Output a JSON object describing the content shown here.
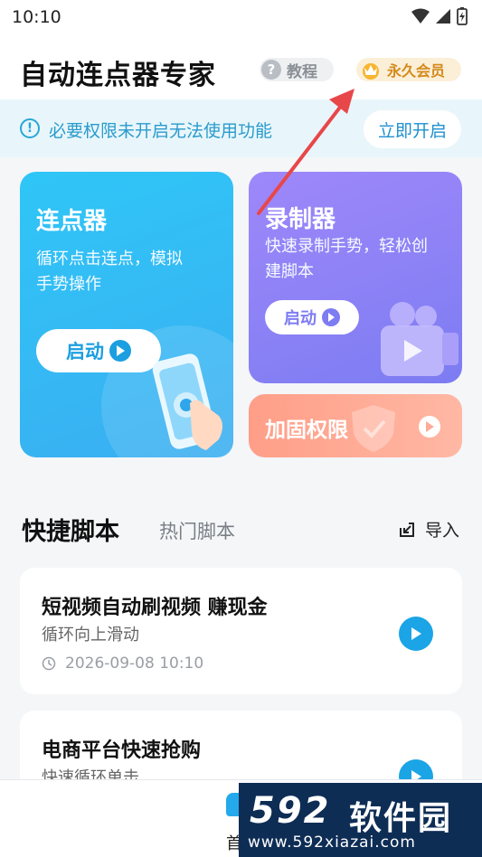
{
  "status_bar": {
    "time": "10:10",
    "icons": [
      "wifi-icon",
      "signal-icon",
      "battery-icon"
    ]
  },
  "header": {
    "title": "自动连点器专家",
    "tutorial_label": "教程",
    "vip_label": "永久会员"
  },
  "notice": {
    "text": "必要权限未开启无法使用功能",
    "button_label": "立即开启"
  },
  "cards": {
    "clicker": {
      "title": "连点器",
      "desc_line1": "循环点击连点，模拟",
      "desc_line2": "手势操作",
      "start_label": "启动"
    },
    "recorder": {
      "title": "录制器",
      "desc_line1": "快速录制手势，轻松创",
      "desc_line2": "建脚本",
      "start_label": "启动"
    },
    "secure": {
      "title": "加固权限"
    }
  },
  "section": {
    "tab_active": "快捷脚本",
    "tab_inactive": "热门脚本",
    "import_label": "导入"
  },
  "scripts": [
    {
      "name": "短视频自动刷视频 赚现金",
      "desc": "循环向上滑动",
      "time": "2026-09-08 10:10"
    },
    {
      "name": "电商平台快速抢购",
      "desc": "快速循环单击"
    }
  ],
  "bottom_nav": {
    "home_label": "首"
  },
  "watermark": {
    "number": "592",
    "text": "软件园",
    "url": "www.592xiazai.com"
  },
  "colors": {
    "accent_blue": "#1ba4e6",
    "clicker_card": "#2fc6f7",
    "recorder_card": "#8f82f6",
    "secure_card": "#ffa994",
    "annotation_arrow": "#e8474a"
  }
}
